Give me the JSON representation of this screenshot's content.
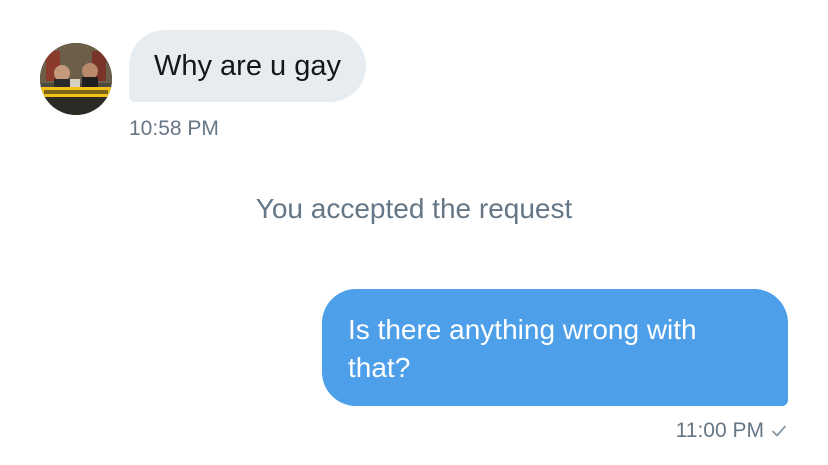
{
  "conversation": {
    "incoming": {
      "text": "Why are u gay",
      "timestamp": "10:58 PM",
      "avatar_icon": "profile-avatar"
    },
    "system_note": "You accepted the request",
    "outgoing": {
      "text": "Is there anything wrong with that?",
      "timestamp": "11:00 PM",
      "status_icon": "check-icon"
    }
  },
  "colors": {
    "incoming_bubble": "#e6ecf0",
    "outgoing_bubble": "#4d9fea",
    "meta_text": "#657786",
    "body_text": "#14171a"
  }
}
